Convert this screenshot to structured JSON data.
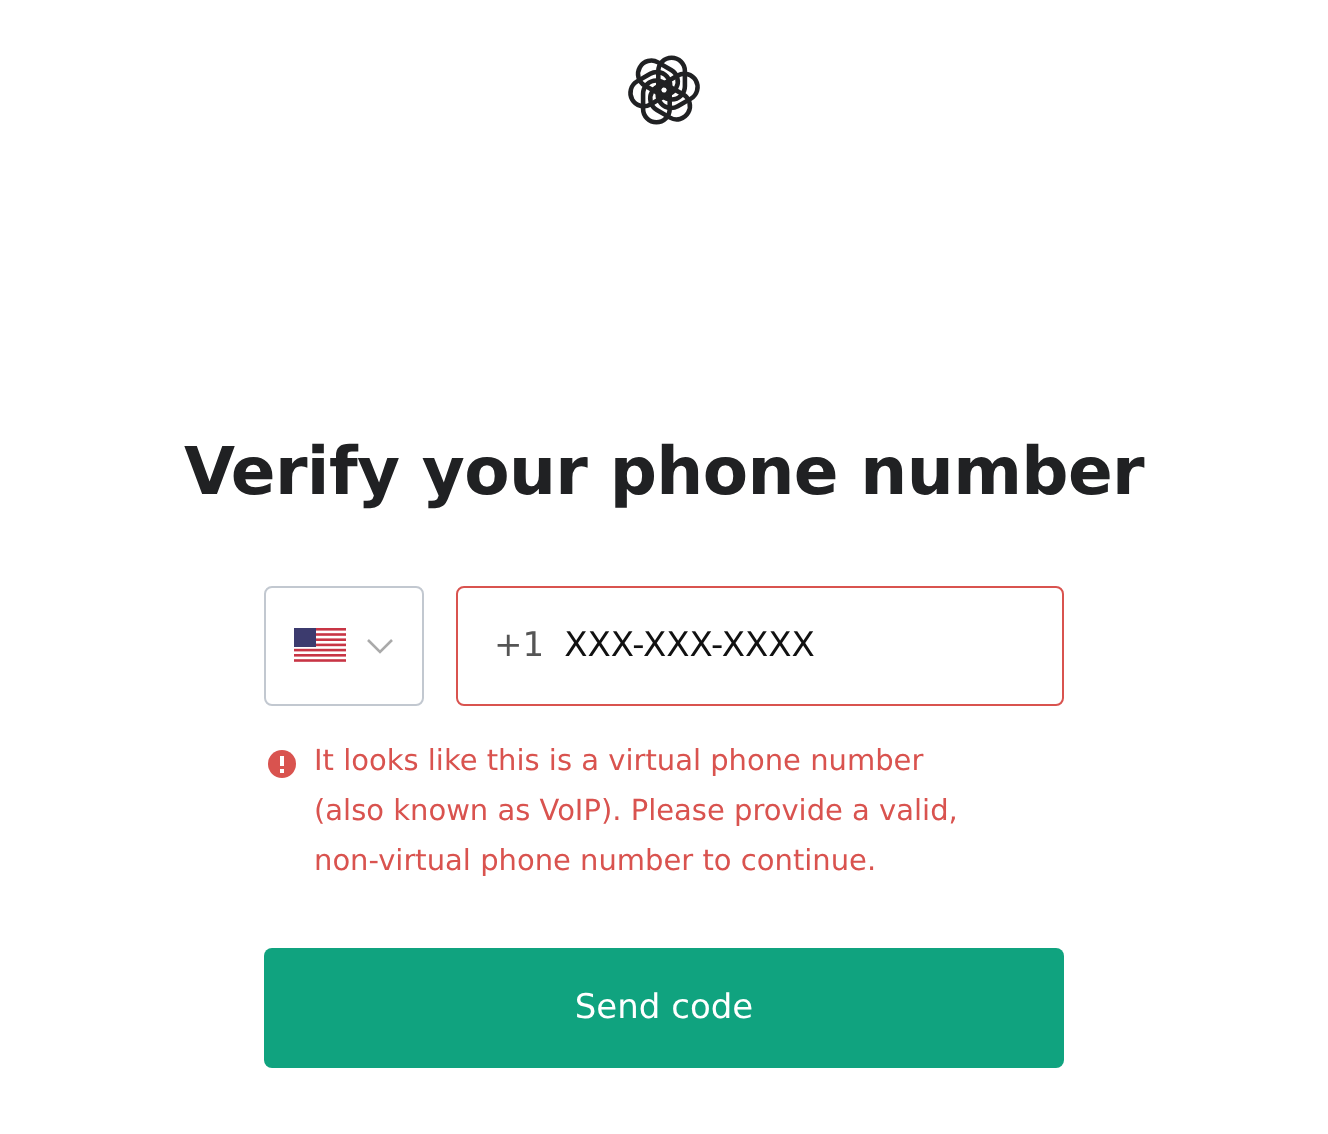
{
  "heading": "Verify your phone number",
  "phone": {
    "country_code": "+1",
    "value": "XXX-XXX-XXXX",
    "invalid": true
  },
  "error": "It looks like this is a virtual phone number (also known as VoIP). Please provide a valid, non-virtual phone number to continue.",
  "submit": {
    "label": "Send code"
  }
}
